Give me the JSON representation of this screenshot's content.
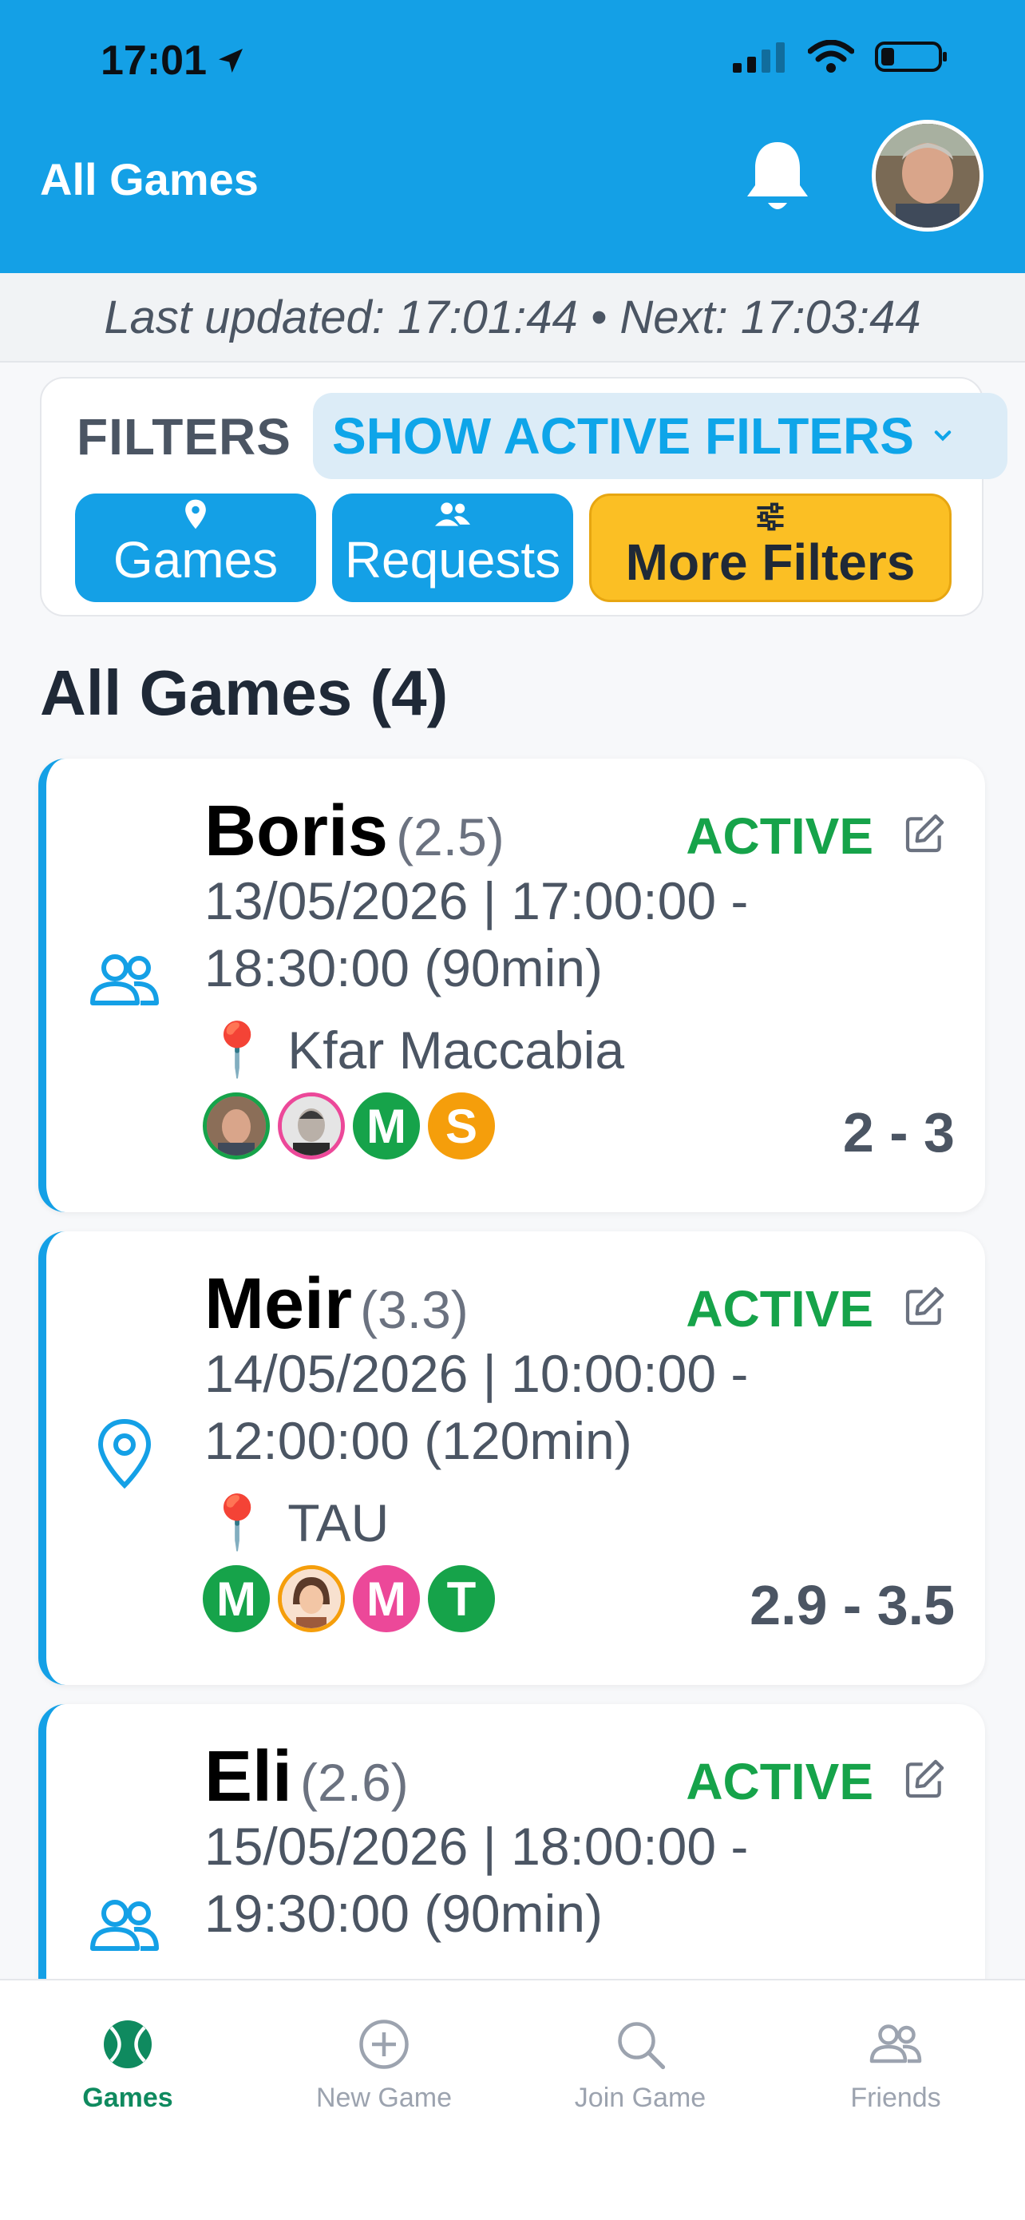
{
  "status_bar": {
    "time": "17:01"
  },
  "header": {
    "title": "All Games"
  },
  "updates": {
    "text": "Last updated: 17:01:44 • Next: 17:03:44"
  },
  "filters": {
    "label": "FILTERS",
    "show_active": "SHOW ACTIVE FILTERS",
    "buttons": [
      {
        "label": "Games",
        "icon": "location-pin-icon"
      },
      {
        "label": "Requests",
        "icon": "people-icon"
      },
      {
        "label": "More Filters",
        "icon": "sliders-icon"
      }
    ]
  },
  "section": {
    "title": "All Games (4)"
  },
  "games": [
    {
      "name": "Boris",
      "rating": "(2.5)",
      "status": "ACTIVE",
      "date_line1": "13/05/2026 | 17:00:00 -",
      "date_line2": "18:30:00 (90min)",
      "location_pin": "📍",
      "location": "Kfar Maccabia",
      "range": "2 - 3",
      "type_icon": "people-icon",
      "players": [
        {
          "kind": "photo",
          "border": "#16a34a"
        },
        {
          "kind": "photo",
          "border": "#ec4899"
        },
        {
          "initial": "M",
          "bg": "#16a34a",
          "border": "#16a34a"
        },
        {
          "initial": "S",
          "bg": "#f59e0b",
          "border": "#f59e0b"
        }
      ]
    },
    {
      "name": "Meir",
      "rating": "(3.3)",
      "status": "ACTIVE",
      "date_line1": "14/05/2026 | 10:00:00 -",
      "date_line2": "12:00:00 (120min)",
      "location_pin": "📍",
      "location": "TAU",
      "range": "2.9 - 3.5",
      "type_icon": "location-pin-icon",
      "players": [
        {
          "initial": "M",
          "bg": "#16a34a",
          "border": "#16a34a"
        },
        {
          "kind": "photo",
          "border": "#f59e0b"
        },
        {
          "initial": "M",
          "bg": "#ec4899",
          "border": "#ec4899"
        },
        {
          "initial": "T",
          "bg": "#16a34a",
          "border": "#16a34a"
        }
      ]
    },
    {
      "name": "Eli",
      "rating": "(2.6)",
      "status": "ACTIVE",
      "date_line1": "15/05/2026 | 18:00:00 -",
      "date_line2": "19:30:00 (90min)",
      "type_icon": "people-icon"
    }
  ],
  "nav": [
    {
      "label": "Games",
      "icon": "tennis-ball-icon",
      "active": true
    },
    {
      "label": "New Game",
      "icon": "plus-circle-icon"
    },
    {
      "label": "Join Game",
      "icon": "search-icon"
    },
    {
      "label": "Friends",
      "icon": "friends-icon"
    }
  ]
}
